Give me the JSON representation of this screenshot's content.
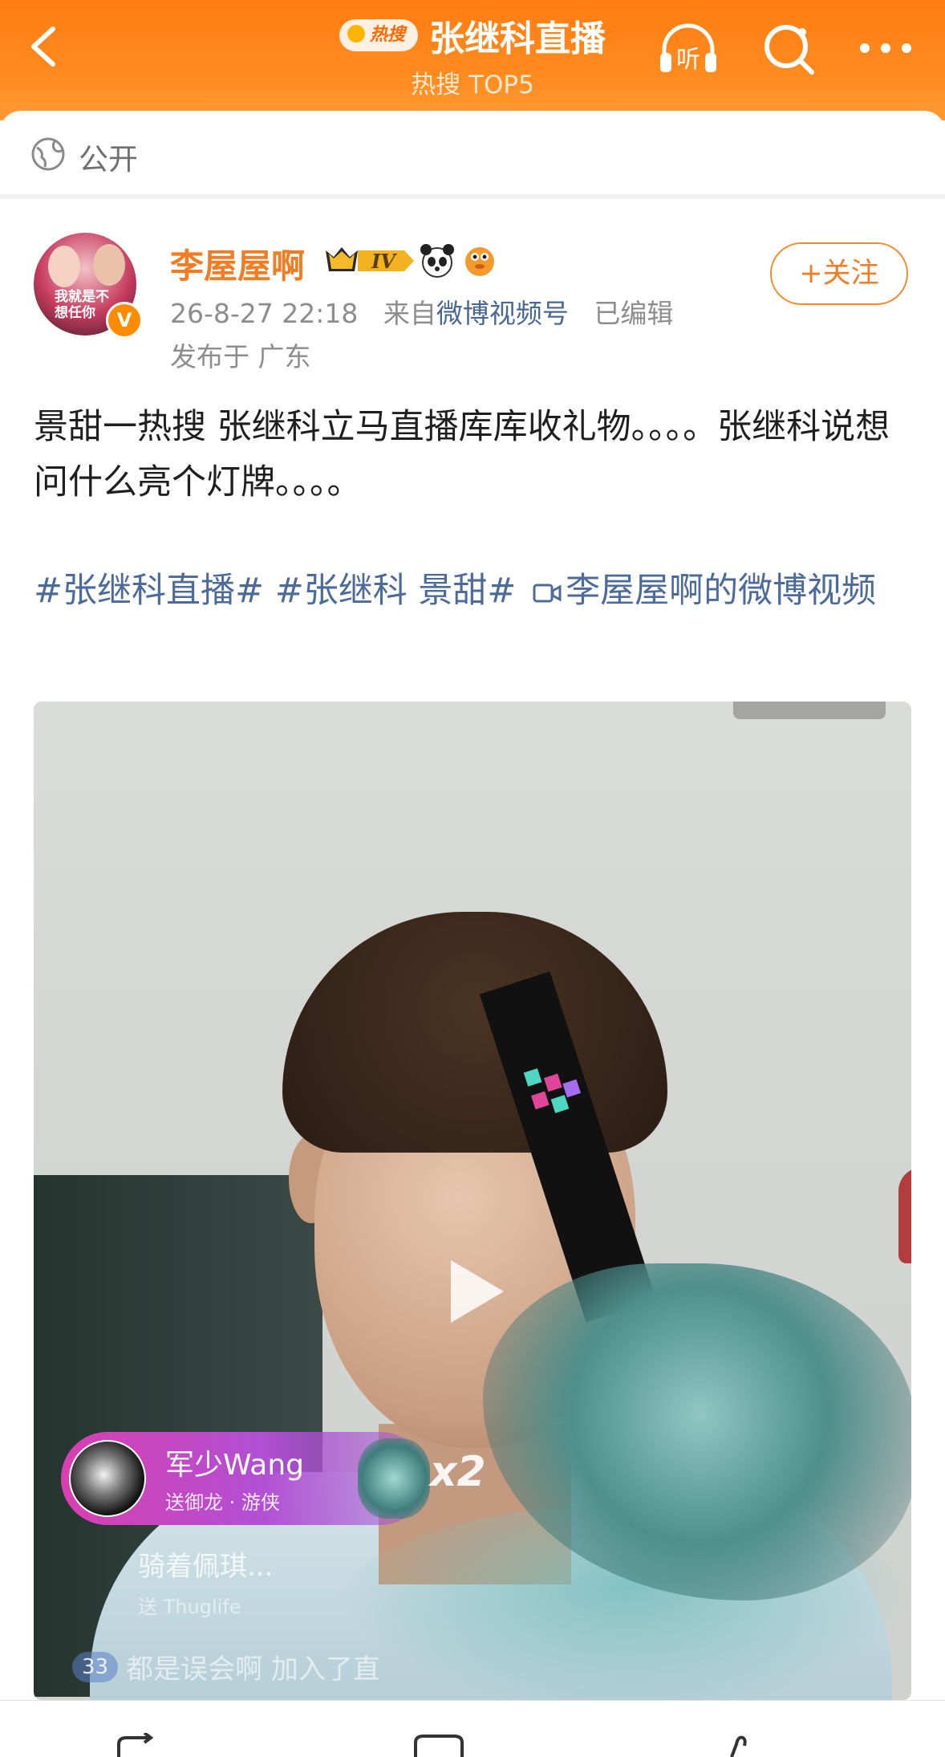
{
  "header": {
    "hot_badge": "热搜",
    "title": "张继科直播",
    "subtitle": "热搜 TOP5",
    "listen_label": "听"
  },
  "visibility": {
    "label": "公开"
  },
  "post": {
    "author": {
      "name": "李屋屋啊",
      "avatar_text": "我就是不想任你",
      "level": "IV"
    },
    "timestamp": "26-8-27 22:18",
    "source_prefix": "来自",
    "source": "微博视频号",
    "edited": "已编辑",
    "location": "发布于 广东",
    "follow_label": "+关注",
    "text": "景甜一热搜 张继科立马直播库库收礼物。。。。张继科说想问什么亮个灯牌。。。。",
    "topics": [
      "#张继科直播#",
      "#张继科 景甜#"
    ],
    "video_link": "李屋屋啊的微博视频"
  },
  "video": {
    "gift": {
      "user": "军少Wang",
      "desc": "送御龙 · 游侠",
      "count": "x2"
    },
    "comment1": "骑着佩琪...",
    "comment1_sub": "送 Thuglife",
    "fans_badge": "33",
    "comment2": "都是误会啊 加入了直"
  },
  "colors": {
    "header_orange": "#ff8a1e",
    "author_orange": "#f07d24",
    "link_blue": "#4c6b99"
  }
}
